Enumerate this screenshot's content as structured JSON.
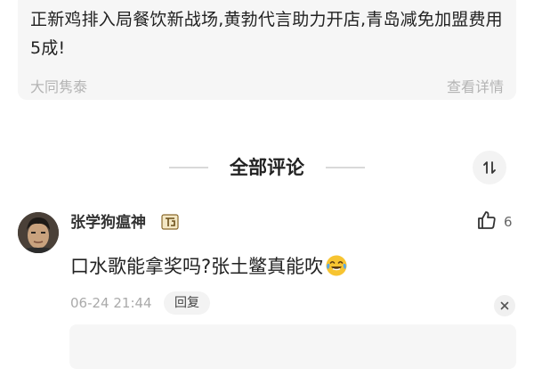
{
  "ad": {
    "title": "正新鸡排入局餐饮新战场,黄勃代言助力开店,青岛减免加盟费用5成!",
    "source": "大同隽泰",
    "detail_link": "查看详情"
  },
  "comments_section": {
    "title": "全部评论"
  },
  "comment": {
    "username": "张学狗瘟神",
    "text": "口水歌能拿奖吗?张土鳖真能吹",
    "emoji": "tears-of-joy-emoji",
    "time": "06-24 21:44",
    "reply_label": "回复",
    "like_count": "6"
  },
  "colors": {
    "card_bg": "#f6f6f6",
    "muted_text": "#b4b4b4",
    "primary_text": "#222222",
    "emoji_yellow": "#f7c431"
  }
}
